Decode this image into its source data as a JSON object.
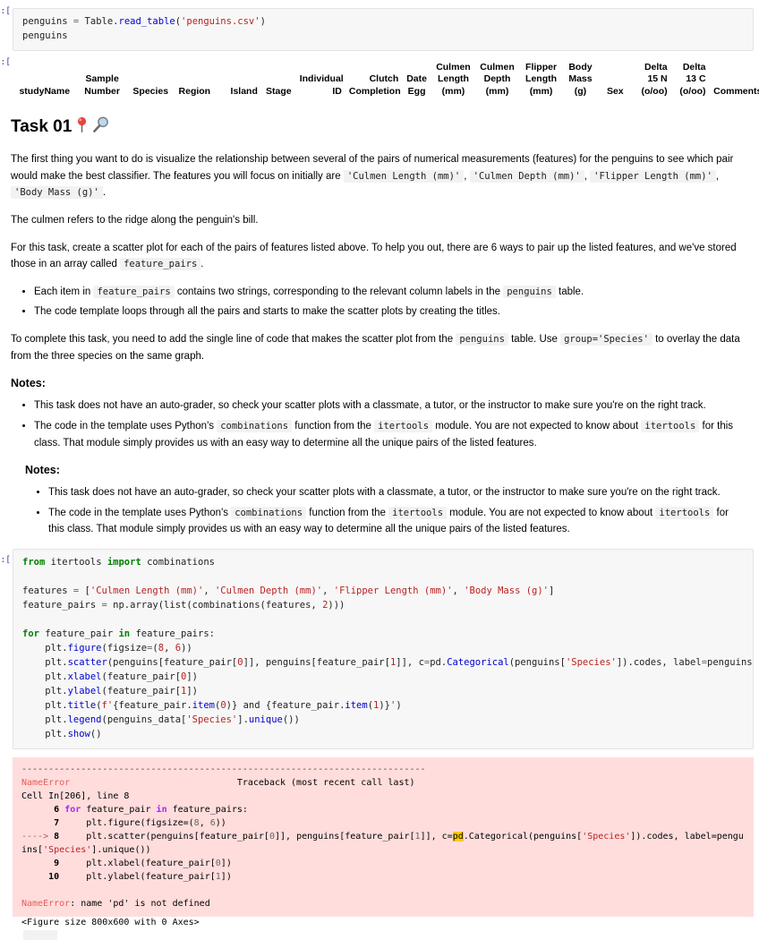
{
  "notebook": {
    "cell1": {
      "prompt": "]:",
      "code_line1_a": "penguins ",
      "code_line1_op": "=",
      "code_line1_b": " Table.",
      "code_line1_fn": "read_table",
      "code_line1_c": "(",
      "code_line1_str": "'penguins.csv'",
      "code_line1_d": ")",
      "code_line2": "penguins"
    },
    "output_table": {
      "prompt": "]:",
      "columns": [
        "studyName",
        "Sample Number",
        "Species",
        "Region",
        "Island",
        "Stage",
        "Individual ID",
        "Clutch Completion",
        "Date Egg",
        "Culmen Length (mm)",
        "Culmen Depth (mm)",
        "Flipper Length (mm)",
        "Body Mass (g)",
        "Sex",
        "Delta 15 N (o/oo)",
        "Delta 13 C (o/oo)",
        "Comments"
      ]
    },
    "markdown": {
      "title": "Task 01",
      "pin_icon": "round-pushpin-icon",
      "magnifier_icon": "magnifying-glass-icon",
      "p1_part1": "The first thing you want to do is visualize the relationship between several of the pairs of numerical measurements (features) for the penguins to see which pair would make the best classifier. The features you will focus on initially are ",
      "p1_code1": "'Culmen Length (mm)'",
      "p1_sep1": ", ",
      "p1_code2": "'Culmen Depth (mm)'",
      "p1_sep2": ", ",
      "p1_code3": "'Flipper Length (mm)'",
      "p1_sep3": ", ",
      "p1_code4": "'Body Mass (g)'",
      "p1_end": ".",
      "p2": "The culmen refers to the ridge along the penguin's bill.",
      "p3_part1": "For this task, create a scatter plot for each of the pairs of features listed above. To help you out, there are 6 ways to pair up the listed features, and we've stored those in an array called ",
      "p3_code": "feature_pairs",
      "p3_end": ".",
      "li1_a": "Each item in ",
      "li1_code1": "feature_pairs",
      "li1_b": " contains two strings, corresponding to the relevant column labels in the ",
      "li1_code2": "penguins",
      "li1_c": " table.",
      "li2": "The code template loops through all the pairs and starts to make the scatter plots by creating the titles.",
      "p4_a": "To complete this task, you need to add the single line of code that makes the scatter plot from the ",
      "p4_code1": "penguins",
      "p4_b": " table. Use ",
      "p4_code2": "group='Species'",
      "p4_c": " to overlay the data from the three species on the same graph.",
      "notes_heading": "Notes:",
      "note1": "This task does not have an auto-grader, so check your scatter plots with a classmate, a tutor, or the instructor to make sure you're on the right track.",
      "note2_a": "The code in the template uses Python's ",
      "note2_code1": "combinations",
      "note2_b": " function from the ",
      "note2_code2": "itertools",
      "note2_c": " module. You are not expected to know about ",
      "note2_code3": "itertools",
      "note2_d": " for this class. That module simply provides us with an easy way to determine all the unique pairs of the listed features."
    },
    "markdown2": {
      "notes_heading": "Notes:",
      "note1": "This task does not have an auto-grader, so check your scatter plots with a classmate, a tutor, or the instructor to make sure you're on the right track.",
      "note2_a": "The code in the template uses Python's ",
      "note2_code1": "combinations",
      "note2_b": " function from the ",
      "note2_code2": "itertools",
      "note2_c": " module. You are not expected to know about ",
      "note2_code3": "itertools",
      "note2_d": " for this class. That module simply provides us with an easy way to determine all the unique pairs of the listed features."
    },
    "cell2": {
      "prompt": "]:"
    },
    "error": {
      "divider": "---------------------------------------------------------------------------",
      "etype": "NameError",
      "tb_label": "Traceback (most recent call last)",
      "cell_line": "Cell In[206], line 8",
      "ln6": "6",
      "ln7": "7",
      "ln8": "8",
      "ln9": "9",
      "ln10": "10",
      "arrow": "----> ",
      "highlight_token": "pd",
      "final_a": "NameError",
      "final_b": ": name 'pd' is not defined",
      "figure_line": "<Figure size 800x600 with 0 Axes>"
    }
  }
}
